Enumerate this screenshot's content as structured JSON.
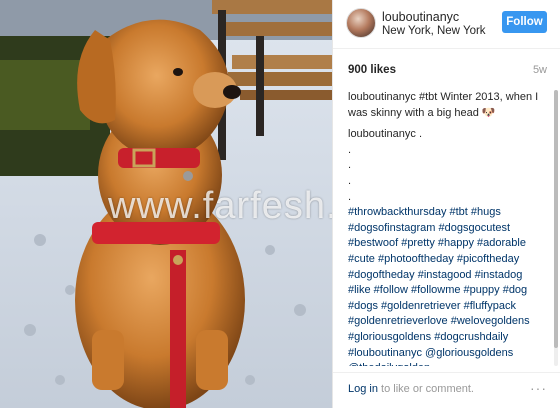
{
  "post": {
    "username": "louboutinanyc",
    "location": "New York, New York",
    "follow_label": "Follow",
    "likes": "900 likes",
    "age": "5w",
    "caption_user": "louboutinanyc",
    "caption_text": "#tbt Winter 2013, when I was skinny with a big head 🐶",
    "comment_user": "louboutinanyc",
    "comment_first": ".",
    "dots": [
      ".",
      ".",
      ".",
      "."
    ],
    "hashtags": "#throwbackthursday #tbt #hugs #dogsofinstagram #dogsgocutest #bestwoof #pretty #happy #adorable #cute #photooftheday #picoftheday #dogoftheday #instagood #instadog #like #follow #followme #puppy #dog #dogs #goldenretriever #fluffypack #goldenretrieverlove #welovegoldens #gloriousgoldens #dogcrushdaily #louboutinanyc @gloriousgoldens @thedailygolden @goldenretrieversfeatures @goldenretrieversworld #dogsofinstagram #dogs"
  },
  "footer": {
    "login_link": "Log in",
    "login_suffix": " to like or comment.",
    "more_label": "···"
  },
  "watermark": "www.farfesh.com"
}
